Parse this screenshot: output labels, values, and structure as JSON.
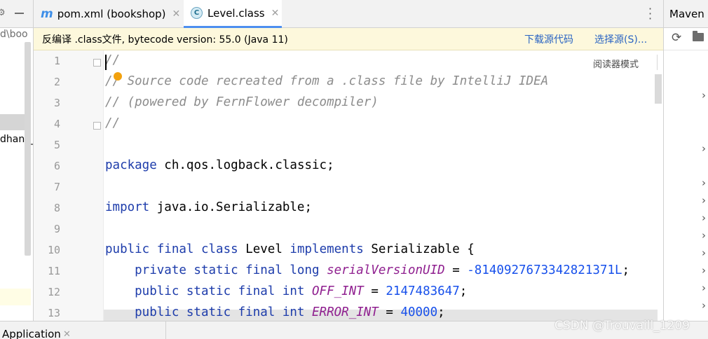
{
  "sidebar": {
    "path_fragment": "d\\boo",
    "node_fragment": "dhand_"
  },
  "tabs": [
    {
      "label": "pom.xml (bookshop)",
      "icon": "maven-m-icon",
      "active": false
    },
    {
      "label": "Level.class",
      "icon": "class-c-icon",
      "active": true
    }
  ],
  "tab_icons": {
    "maven_letter": "m",
    "class_letter": "C"
  },
  "banner": {
    "message": "反编译 .class文件, bytecode version: 55.0 (Java 11)",
    "download_link": "下载源代码",
    "choose_source_link": "选择源(S)..."
  },
  "editor": {
    "reader_mode": "阅读器模式",
    "line_numbers": [
      "1",
      "2",
      "3",
      "4",
      "5",
      "6",
      "7",
      "8",
      "9",
      "10",
      "11",
      "12",
      "13"
    ],
    "lines": [
      {
        "tokens": [
          {
            "t": "//",
            "c": "cmt"
          }
        ]
      },
      {
        "tokens": [
          {
            "t": "// Source code recreated from a .class file by IntelliJ IDEA",
            "c": "cmt"
          }
        ]
      },
      {
        "tokens": [
          {
            "t": "// (powered by FernFlower decompiler)",
            "c": "cmt"
          }
        ]
      },
      {
        "tokens": [
          {
            "t": "//",
            "c": "cmt"
          }
        ]
      },
      {
        "tokens": []
      },
      {
        "tokens": [
          {
            "t": "package",
            "c": "kw"
          },
          {
            "t": " ch.qos.logback.classic;",
            "c": ""
          }
        ]
      },
      {
        "tokens": []
      },
      {
        "tokens": [
          {
            "t": "import",
            "c": "kw"
          },
          {
            "t": " java.io.Serializable;",
            "c": ""
          }
        ]
      },
      {
        "tokens": []
      },
      {
        "tokens": [
          {
            "t": "public final class",
            "c": "kw"
          },
          {
            "t": " Level ",
            "c": ""
          },
          {
            "t": "implements",
            "c": "kw"
          },
          {
            "t": " Serializable {",
            "c": ""
          }
        ]
      },
      {
        "tokens": [
          {
            "t": "    private static final long ",
            "c": "kw"
          },
          {
            "t": "serialVersionUID",
            "c": "fld"
          },
          {
            "t": " = ",
            "c": ""
          },
          {
            "t": "-8140927673342821371L",
            "c": "num"
          },
          {
            "t": ";",
            "c": ""
          }
        ]
      },
      {
        "tokens": [
          {
            "t": "    public static final int ",
            "c": "kw"
          },
          {
            "t": "OFF_INT",
            "c": "fld"
          },
          {
            "t": " = ",
            "c": ""
          },
          {
            "t": "2147483647",
            "c": "num"
          },
          {
            "t": ";",
            "c": ""
          }
        ]
      },
      {
        "tokens": [
          {
            "t": "    public static final int ",
            "c": "kw"
          },
          {
            "t": "ERROR_INT",
            "c": "fld"
          },
          {
            "t": " = ",
            "c": ""
          },
          {
            "t": "40000",
            "c": "num"
          },
          {
            "t": ";",
            "c": ""
          }
        ]
      }
    ]
  },
  "maven": {
    "title": "Maven"
  },
  "bottom": {
    "run_tab": "Application"
  },
  "watermark": "CSDN @Trouvaill_1209",
  "colors": {
    "accent": "#4d8ff0",
    "keyword": "#1d3cab",
    "comment": "#8c8c8c",
    "field": "#8f1f8f",
    "number": "#1750eb",
    "banner_bg": "#fdf8dc",
    "link": "#2a64c3"
  }
}
